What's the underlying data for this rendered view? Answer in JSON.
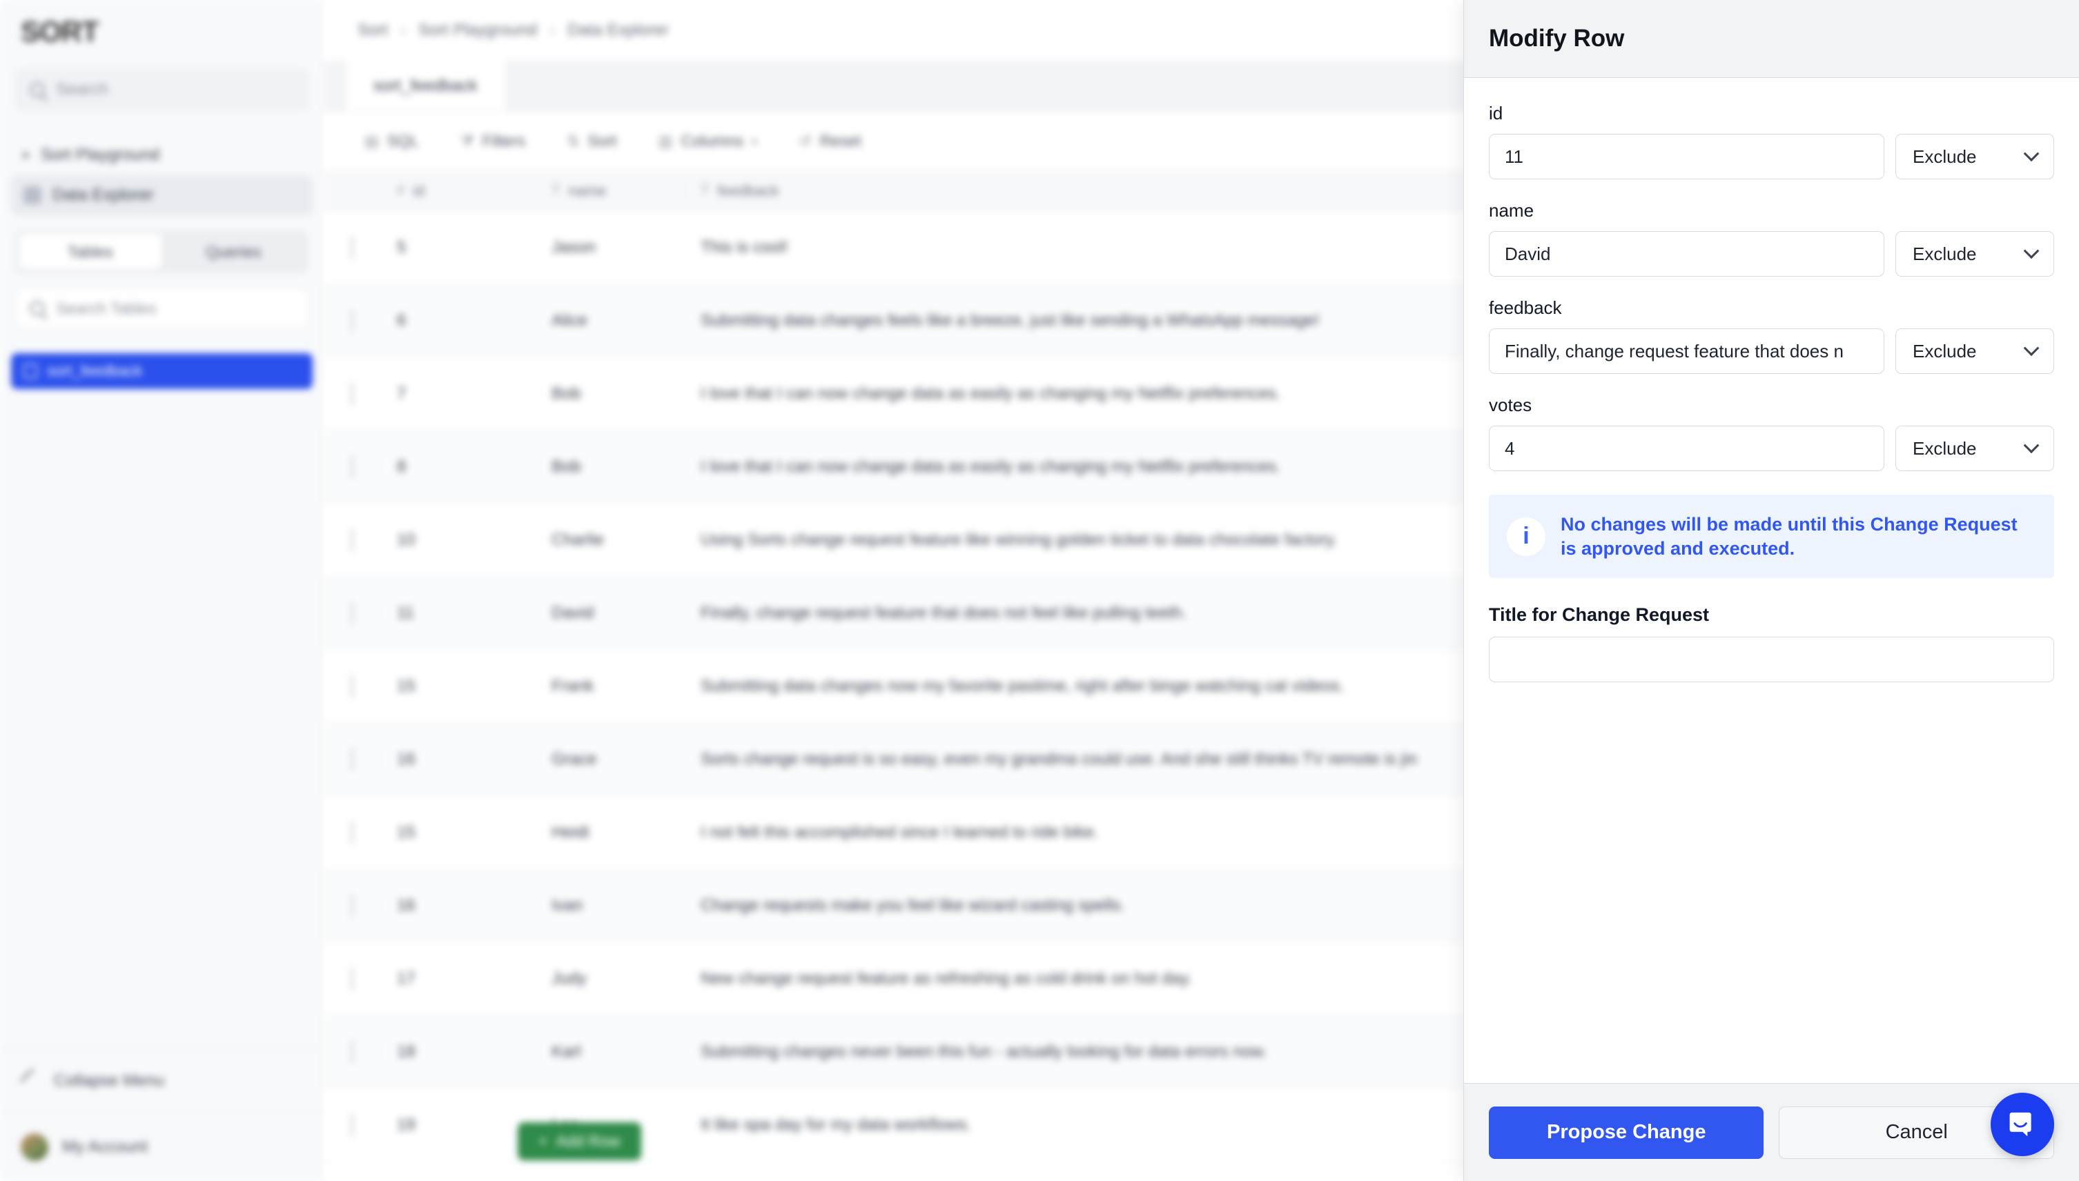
{
  "sidebar": {
    "logo": "SORT",
    "search_placeholder": "Search",
    "nav": [
      {
        "label": "Sort Playground",
        "icon": "chevron-right-icon"
      },
      {
        "label": "Data Explorer",
        "icon": "grid-icon"
      }
    ],
    "segmented": {
      "tables": "Tables",
      "queries": "Queries",
      "selected": "Tables"
    },
    "table_search_placeholder": "Search Tables",
    "tables": [
      {
        "label": "sort_feedback",
        "icon": "table-icon"
      }
    ],
    "collapse_label": "Collapse Menu",
    "account_label": "My Account"
  },
  "main": {
    "breadcrumb": [
      "Sort",
      "Sort Playground",
      "Data Explorer"
    ],
    "breadcrumb_separator": "›",
    "tab": "sort_feedback",
    "toolbar": [
      {
        "label": "SQL",
        "icon": "database-icon"
      },
      {
        "label": "Filters",
        "icon": "filter-icon"
      },
      {
        "label": "Sort",
        "icon": "sort-icon"
      },
      {
        "label": "Columns",
        "icon": "columns-icon"
      },
      {
        "label": "Reset",
        "icon": "reset-icon"
      }
    ],
    "add_row_label": "Add Row",
    "add_row_icon": "plus-icon",
    "table": {
      "columns": [
        "id",
        "name",
        "feedback"
      ],
      "column_icons": [
        "hash-icon",
        "text-icon",
        "text-icon"
      ],
      "rows": [
        {
          "id": "5",
          "name": "Jason",
          "feedback": "This is cool!"
        },
        {
          "id": "6",
          "name": "Alice",
          "feedback": "Submitting data changes feels like a breeze, just like sending a WhatsApp message!"
        },
        {
          "id": "7",
          "name": "Bob",
          "feedback": "I love that I can now change data as easily as changing my Netflix preferences."
        },
        {
          "id": "8",
          "name": "Bob",
          "feedback": "I love that I can now change data as easily as changing my Netflix preferences."
        },
        {
          "id": "10",
          "name": "Charlie",
          "feedback": "Using Sorts change request feature like winning golden ticket to data chocolate factory."
        },
        {
          "id": "11",
          "name": "David",
          "feedback": "Finally, change request feature that does not feel like pulling teeth."
        },
        {
          "id": "15",
          "name": "Frank",
          "feedback": "Submitting data changes now my favorite pastime, right after binge watching cat videos."
        },
        {
          "id": "16",
          "name": "Grace",
          "feedback": "Sorts change request is so easy, even my grandma could use. And she still thinks TV remote is jin"
        },
        {
          "id": "15",
          "name": "Heidi",
          "feedback": "I not felt this accomplished since I learned to ride bike."
        },
        {
          "id": "16",
          "name": "Ivan",
          "feedback": "Change requests make you feel like wizard casting spells."
        },
        {
          "id": "17",
          "name": "Judy",
          "feedback": "New change request feature as refreshing as cold drink on hot day."
        },
        {
          "id": "18",
          "name": "Karl",
          "feedback": "Submitting changes never been this fun - actually looking for data errors now."
        },
        {
          "id": "19",
          "name": "Leo",
          "feedback": "It like spa day for my data workflows."
        }
      ]
    }
  },
  "panel": {
    "title": "Modify Row",
    "fields": [
      {
        "label": "id",
        "value": "11",
        "mode": "Exclude"
      },
      {
        "label": "name",
        "value": "David",
        "mode": "Exclude"
      },
      {
        "label": "feedback",
        "value": "Finally, change request feature that does n",
        "mode": "Exclude"
      },
      {
        "label": "votes",
        "value": "4",
        "mode": "Exclude"
      }
    ],
    "notice": {
      "icon": "info-icon",
      "text": "No changes will be made until this Change Request is approved and executed."
    },
    "title_for_cr_label": "Title for Change Request",
    "title_for_cr_value": "",
    "title_for_cr_placeholder": "",
    "propose_label": "Propose Change",
    "cancel_label": "Cancel"
  },
  "widgets": {
    "intercom_icon": "chat-bubble-icon"
  },
  "colors": {
    "accent": "#3257f0",
    "sidebar_selected": "#2b50ec",
    "add_row_green": "#2e8b49",
    "notice_bg": "#eef4fe",
    "notice_text": "#3257f0"
  }
}
